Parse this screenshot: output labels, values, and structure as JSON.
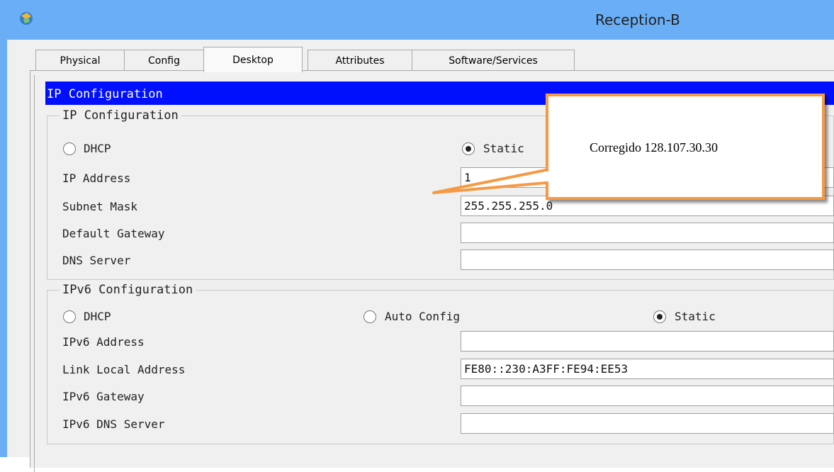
{
  "window": {
    "title": "Reception-B",
    "app_icon": "packet-tracer-icon"
  },
  "tabs": [
    {
      "label": "Physical",
      "active": false
    },
    {
      "label": "Config",
      "active": false
    },
    {
      "label": "Desktop",
      "active": true
    },
    {
      "label": "Attributes",
      "active": false
    },
    {
      "label": "Software/Services",
      "active": false
    }
  ],
  "header": {
    "title": "IP Configuration"
  },
  "ipv4": {
    "legend": "IP Configuration",
    "dhcp_label": "DHCP",
    "static_label": "Static",
    "mode": "Static",
    "ip_address_label": "IP Address",
    "ip_address_value": "1",
    "subnet_mask_label": "Subnet Mask",
    "subnet_mask_value": "255.255.255.0",
    "default_gateway_label": "Default Gateway",
    "default_gateway_value": "",
    "dns_server_label": "DNS Server",
    "dns_server_value": ""
  },
  "ipv6": {
    "legend": "IPv6 Configuration",
    "dhcp_label": "DHCP",
    "auto_config_label": "Auto Config",
    "static_label": "Static",
    "mode": "Static",
    "ipv6_address_label": "IPv6 Address",
    "ipv6_address_value": "",
    "link_local_label": "Link Local Address",
    "link_local_value": "FE80::230:A3FF:FE94:EE53",
    "ipv6_gateway_label": "IPv6 Gateway",
    "ipv6_gateway_value": "",
    "ipv6_dns_label": "IPv6 DNS Server",
    "ipv6_dns_value": ""
  },
  "annotation": {
    "text": "Corregido 128.107.30.30",
    "border_color": "#f59a44"
  },
  "colors": {
    "titlebar": "#6aaef5",
    "header_bar": "#0010ff"
  }
}
